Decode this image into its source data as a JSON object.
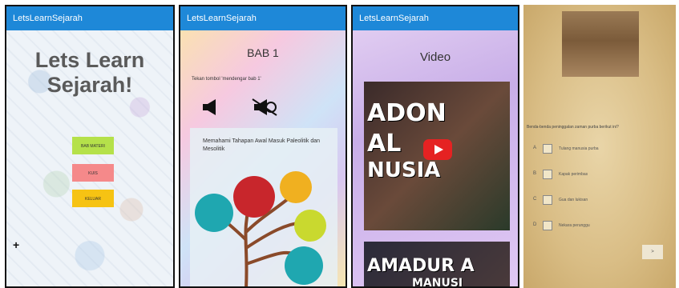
{
  "screens": [
    {
      "title": "LetsLearnSejarah",
      "headline_line1": "Lets Learn",
      "headline_line2": "Sejarah!",
      "menu_buttons": [
        {
          "label": "BAB MATERI",
          "color": "#b5e14a"
        },
        {
          "label": "KUIS",
          "color": "#f5898a"
        },
        {
          "label": "KELUAR",
          "color": "#f6c313"
        }
      ],
      "add_label": "+"
    },
    {
      "title": "LetsLearnSejarah",
      "heading": "BAB 1",
      "hint": "Tekan tombol 'mendengar bab 1'",
      "card_title": "Memahami Tahapan Awal Masuk Paleolitik dan Mesolitik",
      "mindmap_nodes": [
        {
          "label": "",
          "color": "#c8262c"
        },
        {
          "label": "",
          "color": "#e0312f"
        },
        {
          "label": "",
          "color": "#f0b020"
        },
        {
          "label": "",
          "color": "#1fa7b0"
        },
        {
          "label": "",
          "color": "#1fa7b0"
        },
        {
          "label": "",
          "color": "#c9d92f"
        }
      ]
    },
    {
      "title": "LetsLearnSejarah",
      "heading": "Video",
      "video1_lines": [
        "ADON",
        "AL",
        "NUSIA"
      ],
      "video2_line1": "AMADUR A",
      "video2_line2": "MANUSI"
    },
    {
      "question": "Benda-benda peninggalan zaman purba berikut ini?",
      "options": [
        {
          "letter": "A",
          "text": "Tulang manusia purba"
        },
        {
          "letter": "B",
          "text": "Kapak perimbas"
        },
        {
          "letter": "C",
          "text": "Gua dan lukisan"
        },
        {
          "letter": "D",
          "text": "Nekara perunggu"
        }
      ],
      "next_label": ">"
    }
  ]
}
